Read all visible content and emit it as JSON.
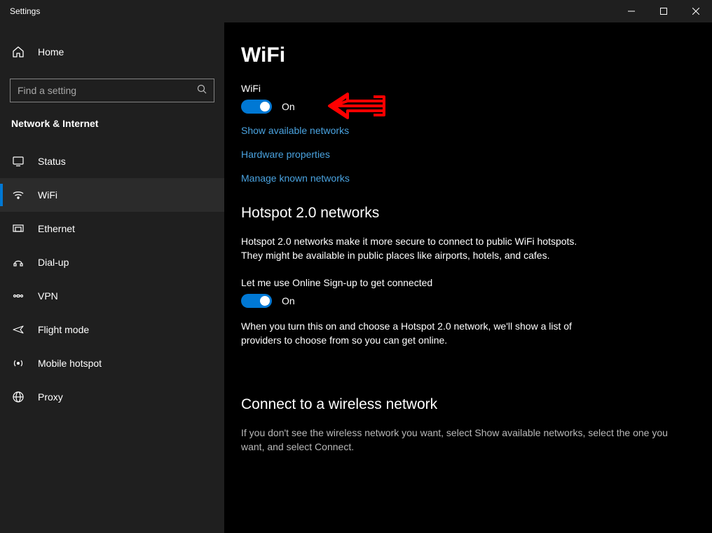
{
  "window": {
    "title": "Settings"
  },
  "sidebar": {
    "home": "Home",
    "search_placeholder": "Find a setting",
    "category": "Network & Internet",
    "items": [
      {
        "label": "Status"
      },
      {
        "label": "WiFi"
      },
      {
        "label": "Ethernet"
      },
      {
        "label": "Dial-up"
      },
      {
        "label": "VPN"
      },
      {
        "label": "Flight mode"
      },
      {
        "label": "Mobile hotspot"
      },
      {
        "label": "Proxy"
      }
    ]
  },
  "main": {
    "title": "WiFi",
    "wifi": {
      "label": "WiFi",
      "toggle_state": "On"
    },
    "links": {
      "show_networks": "Show available networks",
      "hardware_props": "Hardware properties",
      "known_networks": "Manage known networks"
    },
    "hotspot": {
      "heading": "Hotspot 2.0 networks",
      "desc": "Hotspot 2.0 networks make it more secure to connect to public WiFi hotspots. They might be available in public places like airports, hotels, and cafes.",
      "signup_label": "Let me use Online Sign-up to get connected",
      "toggle_state": "On",
      "note": "When you turn this on and choose a Hotspot 2.0 network, we'll show a list of providers to choose from so you can get online."
    },
    "connect": {
      "heading": "Connect to a wireless network",
      "desc": "If you don't see the wireless network you want, select Show available networks, select the one you want, and select Connect."
    }
  }
}
